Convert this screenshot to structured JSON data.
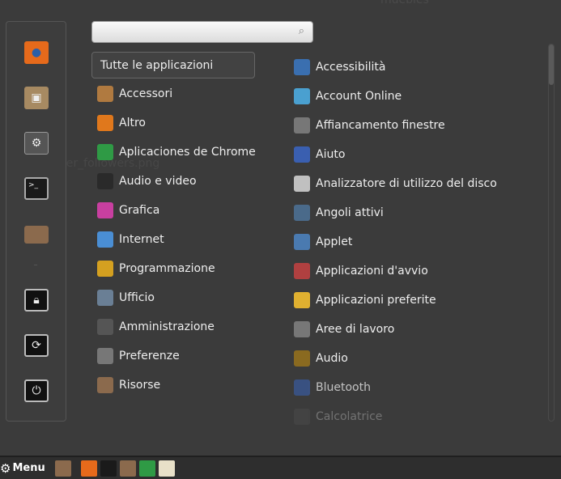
{
  "desktop": {
    "label_top": "muebles",
    "label_file": "twitter_followers.png"
  },
  "favorites": [
    {
      "name": "firefox",
      "color": "#e66a1b"
    },
    {
      "name": "software-package",
      "color": "#a78a62"
    },
    {
      "name": "system-settings",
      "color": "#555555"
    },
    {
      "name": "terminal",
      "color": "#1a1a1a"
    },
    {
      "name": "folder",
      "color": "#8b6a4d"
    }
  ],
  "session": [
    {
      "name": "lock-screen"
    },
    {
      "name": "logout"
    },
    {
      "name": "shutdown"
    }
  ],
  "search": {
    "value": "",
    "placeholder": ""
  },
  "all_apps_label": "Tutte le applicazioni",
  "categories": [
    {
      "label": "Accessori",
      "color": "#b07a40"
    },
    {
      "label": "Altro",
      "color": "#e0781c"
    },
    {
      "label": "Aplicaciones de Chrome",
      "color": "#2f9a45"
    },
    {
      "label": "Audio e video",
      "color": "#2a2a2a"
    },
    {
      "label": "Grafica",
      "color": "#c83fa0"
    },
    {
      "label": "Internet",
      "color": "#4a8ed4"
    },
    {
      "label": "Programmazione",
      "color": "#d4a020"
    },
    {
      "label": "Ufficio",
      "color": "#6a7f95"
    },
    {
      "label": "Amministrazione",
      "color": "#555555"
    },
    {
      "label": "Preferenze",
      "color": "#777777"
    },
    {
      "label": "Risorse",
      "color": "#8b6a4d"
    }
  ],
  "apps": [
    {
      "label": "Accessibilità",
      "color": "#3a6fb0"
    },
    {
      "label": "Account Online",
      "color": "#4aa0d0"
    },
    {
      "label": "Affiancamento finestre",
      "color": "#777777"
    },
    {
      "label": "Aiuto",
      "color": "#3a5fb0"
    },
    {
      "label": "Analizzatore di utilizzo del disco",
      "color": "#c0c0c0"
    },
    {
      "label": "Angoli attivi",
      "color": "#4a6a8a"
    },
    {
      "label": "Applet",
      "color": "#4a7ab0"
    },
    {
      "label": "Applicazioni d'avvio",
      "color": "#b04040"
    },
    {
      "label": "Applicazioni preferite",
      "color": "#e0b030"
    },
    {
      "label": "Aree di lavoro",
      "color": "#777777"
    },
    {
      "label": "Audio",
      "color": "#8a6a20"
    },
    {
      "label": "Bluetooth",
      "color": "#3a5a9a"
    },
    {
      "label": "Calcolatrice",
      "color": "#555555"
    }
  ],
  "taskbar": {
    "menu_label": "Menu",
    "launchers": [
      {
        "name": "show-desktop",
        "color": "#8b6a4d"
      },
      {
        "name": "firefox",
        "color": "#e66a1b"
      },
      {
        "name": "terminal",
        "color": "#1a1a1a"
      },
      {
        "name": "folder",
        "color": "#8b6a4d"
      },
      {
        "name": "chrome",
        "color": "#2f9a45"
      },
      {
        "name": "text-editor",
        "color": "#e8e0c8"
      }
    ]
  }
}
